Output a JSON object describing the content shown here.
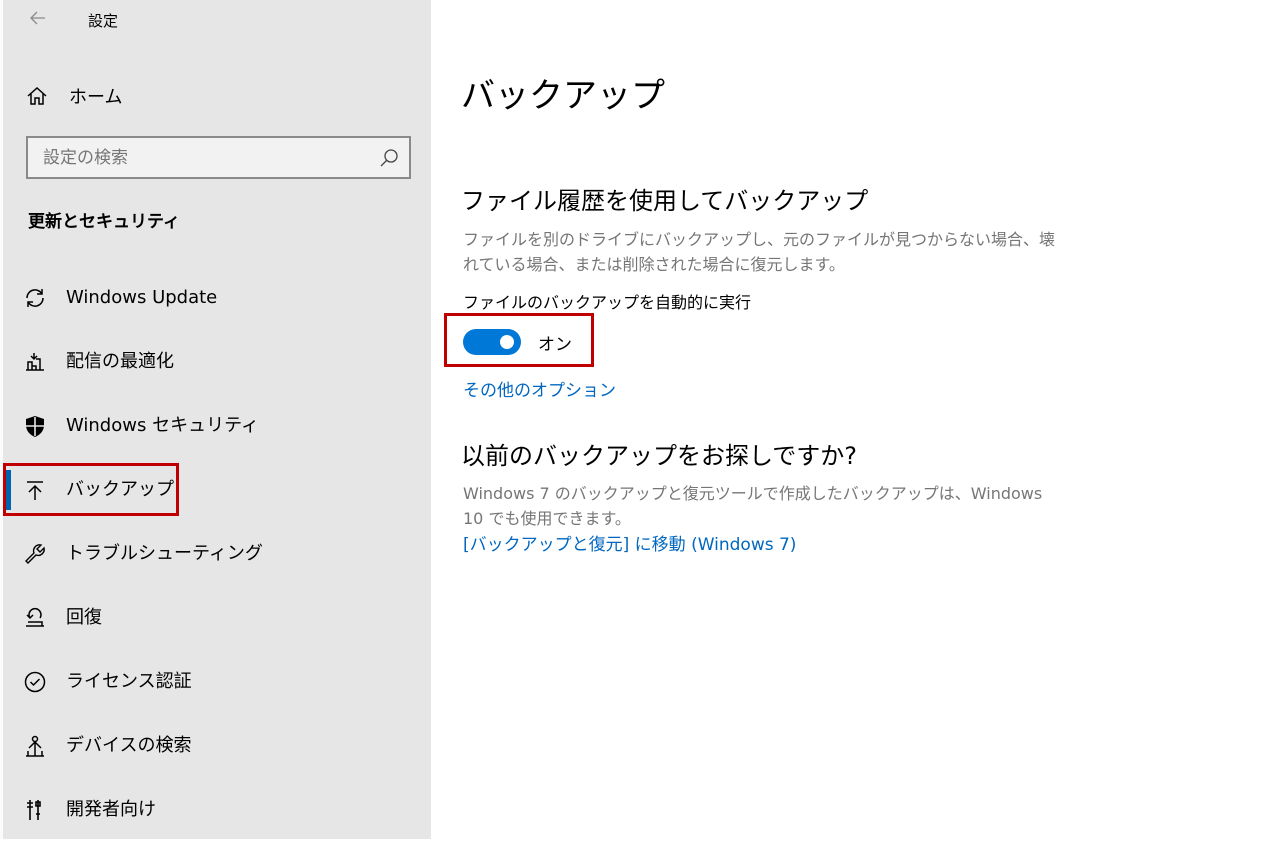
{
  "app": {
    "title": "設定"
  },
  "sidebar": {
    "home_label": "ホーム",
    "search_placeholder": "設定の検索",
    "section_title": "更新とセキュリティ",
    "items": [
      {
        "label": "Windows Update",
        "icon": "refresh-icon"
      },
      {
        "label": "配信の最適化",
        "icon": "delivery-optimization-icon"
      },
      {
        "label": "Windows セキュリティ",
        "icon": "shield-icon"
      },
      {
        "label": "バックアップ",
        "icon": "backup-arrow-up-icon",
        "selected": true
      },
      {
        "label": "トラブルシューティング",
        "icon": "wrench-icon"
      },
      {
        "label": "回復",
        "icon": "recovery-icon"
      },
      {
        "label": "ライセンス認証",
        "icon": "check-circle-icon"
      },
      {
        "label": "デバイスの検索",
        "icon": "find-device-icon"
      },
      {
        "label": "開発者向け",
        "icon": "developer-tools-icon"
      }
    ]
  },
  "main": {
    "page_title": "バックアップ",
    "file_history": {
      "heading": "ファイル履歴を使用してバックアップ",
      "description": "ファイルを別のドライブにバックアップし、元のファイルが見つからない場合、壊れている場合、または削除された場合に復元します。",
      "auto_backup_label": "ファイルのバックアップを自動的に実行",
      "toggle_state": "オン",
      "toggle_on": true,
      "more_options_link": "その他のオプション"
    },
    "older_backup": {
      "heading": "以前のバックアップをお探しですか?",
      "description": "Windows 7 のバックアップと復元ツールで作成したバックアップは、Windows 10 でも使用できます。",
      "link": "[バックアップと復元] に移動 (Windows 7)"
    }
  },
  "colors": {
    "accent": "#0078d7",
    "link": "#0067c0",
    "highlight_box": "#c00000",
    "sidebar_bg": "#e6e6e6"
  }
}
